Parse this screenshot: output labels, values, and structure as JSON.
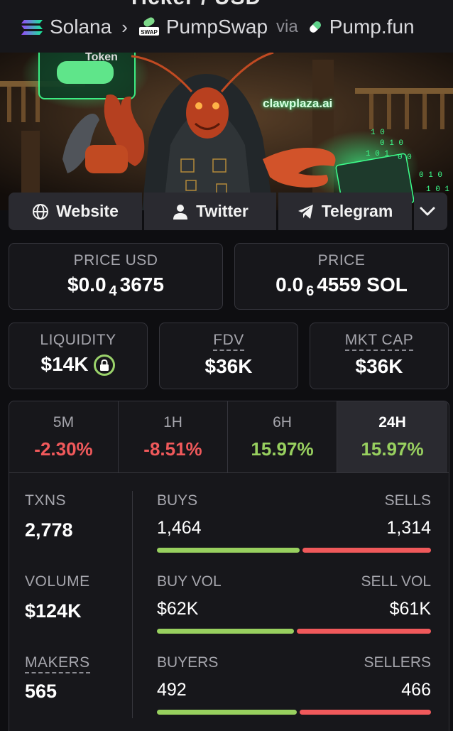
{
  "header": {
    "clipped_title": "Ticker / USD",
    "chain": "Solana",
    "dex": "PumpSwap",
    "dex_icon_text": "SWAP",
    "via": "via",
    "launchpad": "Pump.fun"
  },
  "banner": {
    "site_text": "clawplaza.ai",
    "token_text": "Token"
  },
  "links": {
    "website": "Website",
    "twitter": "Twitter",
    "telegram": "Telegram"
  },
  "price": {
    "usd_label": "PRICE USD",
    "usd_prefix": "$0.0",
    "usd_zeros": "4",
    "usd_digits": "3675",
    "native_label": "PRICE",
    "native_prefix": "0.0",
    "native_zeros": "6",
    "native_digits": "4559 SOL"
  },
  "metrics": {
    "liquidity_label": "LIQUIDITY",
    "liquidity_value": "$14K",
    "fdv_label": "FDV",
    "fdv_value": "$36K",
    "mcap_label": "MKT CAP",
    "mcap_value": "$36K"
  },
  "timeframes": [
    {
      "label": "5M",
      "value": "-2.30%"
    },
    {
      "label": "1H",
      "value": "-8.51%"
    },
    {
      "label": "6H",
      "value": "15.97%"
    },
    {
      "label": "24H",
      "value": "15.97%"
    }
  ],
  "stats": {
    "txns_label": "TXNS",
    "txns_value": "2,778",
    "volume_label": "VOLUME",
    "volume_value": "$124K",
    "makers_label": "MAKERS",
    "makers_value": "565",
    "buys_label": "BUYS",
    "buys_value": "1,464",
    "sells_label": "SELLS",
    "sells_value": "1,314",
    "buy_vol_label": "BUY VOL",
    "buy_vol_value": "$62K",
    "sell_vol_label": "SELL VOL",
    "sell_vol_value": "$61K",
    "buyers_label": "BUYERS",
    "buyers_value": "492",
    "sellers_label": "SELLERS",
    "sellers_value": "466"
  },
  "colors": {
    "positive": "#98d05f",
    "negative": "#f0595b",
    "panel": "#17171b"
  }
}
